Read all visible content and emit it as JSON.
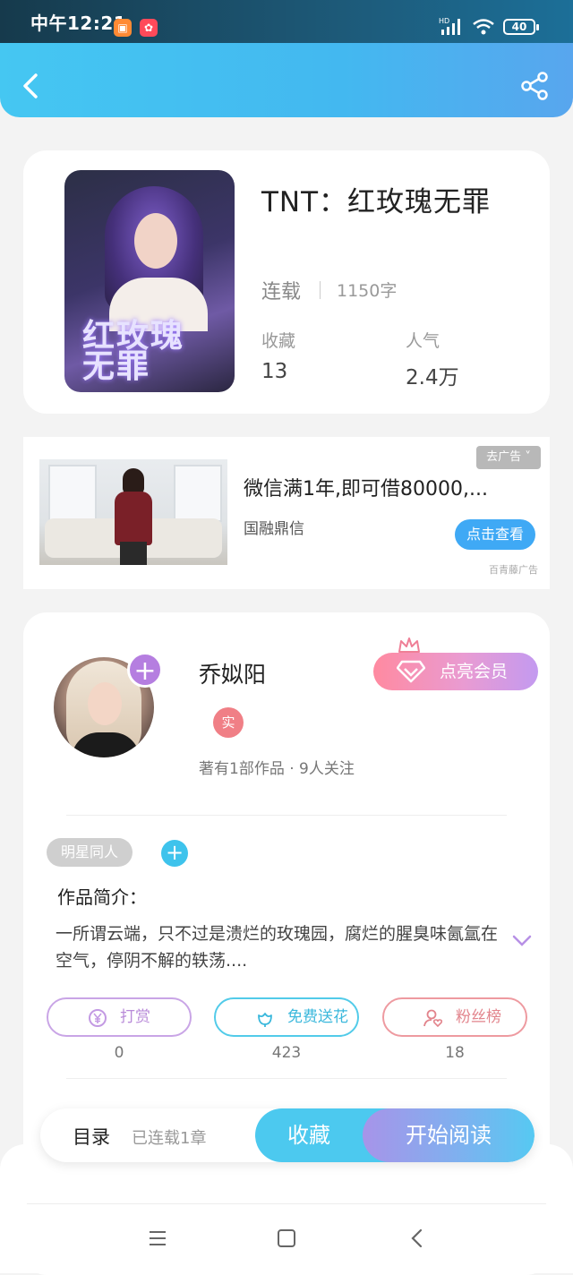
{
  "status_bar": {
    "time": "中午12:21",
    "battery": "40",
    "signal_label": "HD"
  },
  "book": {
    "title": "TNT：红玫瑰无罪",
    "status": "连载",
    "words": "1150字",
    "collect_label": "收藏",
    "collect_value": "13",
    "popularity_label": "人气",
    "popularity_value": "2.4万",
    "cover_title": "红玫瑰无罪"
  },
  "ad": {
    "close_label": "去广告",
    "title": "微信满1年,即可借80000,...",
    "brand": "国融鼎信",
    "button": "点击查看",
    "source": "百青藤广告"
  },
  "author": {
    "name": "乔姒阳",
    "verified": "实",
    "meta": "著有1部作品 · 9人关注",
    "vip_button": "点亮会员",
    "follow": "+"
  },
  "tags": {
    "items": [
      "明星同人"
    ],
    "add": "+"
  },
  "intro": {
    "label": "作品简介：",
    "text": "一所谓云端，只不过是溃烂的玫瑰园，腐烂的腥臭味氤氲在空气，停阴不解的轶荡...."
  },
  "actions": [
    {
      "label": "打赏",
      "count": "0"
    },
    {
      "label": "免费送花",
      "count": "423"
    },
    {
      "label": "粉丝榜",
      "count": "18"
    }
  ],
  "bottom_bar": {
    "toc": "目录",
    "chapters": "已连载1章",
    "collect": "收藏",
    "read": "开始阅读"
  },
  "colors": {
    "header": "#45c7f2",
    "accent_blue": "#4cc9ef",
    "accent_purple": "#b57ee0",
    "vip_pink": "#ff8aa0"
  }
}
